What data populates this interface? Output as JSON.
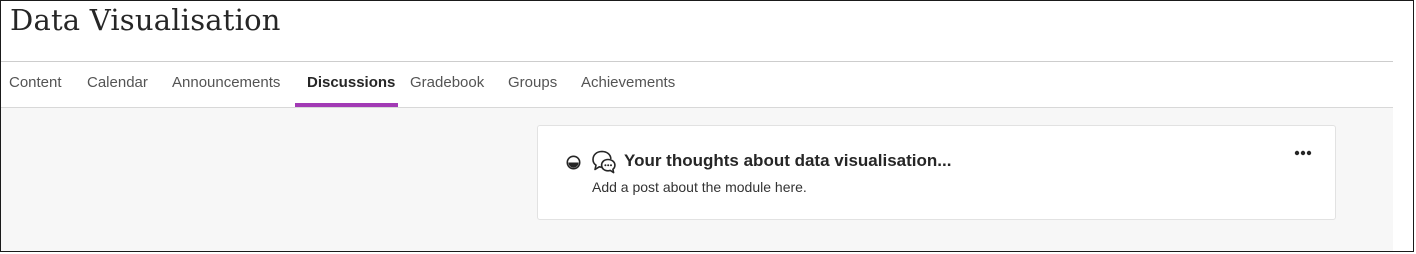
{
  "page": {
    "title": "Data Visualisation"
  },
  "tabs": [
    {
      "label": "Content",
      "active": false
    },
    {
      "label": "Calendar",
      "active": false
    },
    {
      "label": "Announcements",
      "active": false
    },
    {
      "label": "Discussions",
      "active": true
    },
    {
      "label": "Gradebook",
      "active": false
    },
    {
      "label": "Groups",
      "active": false
    },
    {
      "label": "Achievements",
      "active": false
    }
  ],
  "discussion": {
    "title": "Your thoughts about data visualisation...",
    "description": "Add a post about the module here.",
    "status_icon": "half-visibility-icon",
    "type_icon": "discussion-bubbles-icon",
    "more_icon": "more-options-icon"
  },
  "colors": {
    "accent": "#a23ab5",
    "content_background": "#f7f7f7",
    "text_primary": "#262626"
  }
}
